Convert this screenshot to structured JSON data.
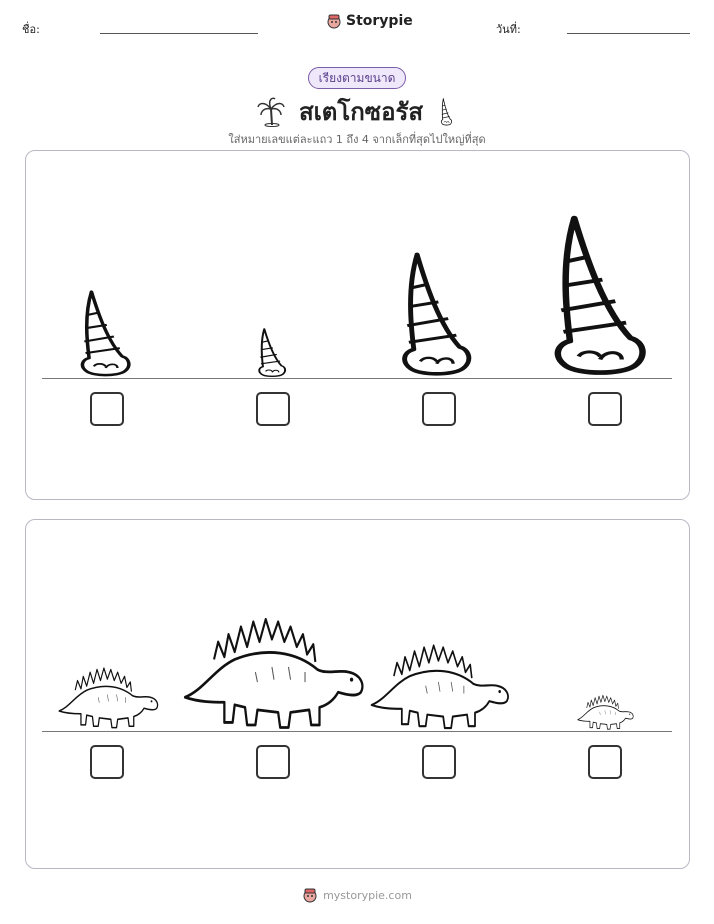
{
  "header": {
    "name_label": "ชื่อ:",
    "date_label": "วันที่:",
    "brand": "Storypie"
  },
  "activity": {
    "tag": "เรียงตามขนาด",
    "title": "สเตโกซอรัส",
    "instruction": "ใส่หมายเลขแต่ละแถว 1 ถึง 4 จากเล็กที่สุดไปใหญ่ที่สุด"
  },
  "rows": [
    {
      "item": "spike",
      "answer_boxes": [
        "",
        "",
        "",
        ""
      ]
    },
    {
      "item": "stegosaurus",
      "answer_boxes": [
        "",
        "",
        "",
        ""
      ]
    }
  ],
  "icons": [
    "palm-tree-icon",
    "spike-icon",
    "storypie-logo-icon"
  ],
  "footer": {
    "url": "mystorypie.com"
  },
  "colors": {
    "accent": "#7b5ea7",
    "pill_bg": "#efe8fb",
    "panel_border": "#b9b9c6"
  }
}
